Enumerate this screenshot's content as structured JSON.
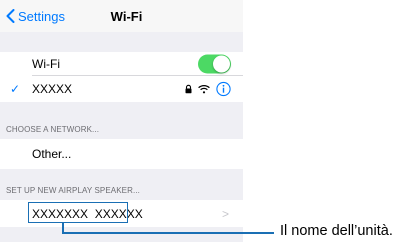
{
  "navbar": {
    "back_label": "Settings",
    "title": "Wi-Fi"
  },
  "wifi_row": {
    "label": "Wi-Fi",
    "toggle_on": true
  },
  "connected_network": {
    "check": "✓",
    "name": "XXXXX"
  },
  "choose_network": {
    "header": "CHOOSE A NETWORK...",
    "other_label": "Other..."
  },
  "airplay": {
    "header": "SET UP NEW AIRPLAY SPEAKER...",
    "device_name": "XXXXXXX  XXXXXX",
    "chevron": ">"
  },
  "annotation": {
    "text": "Il nome dell’unità."
  },
  "colors": {
    "accent": "#007aff",
    "toggle_on": "#4cd964",
    "callout": "#1a6fb4"
  }
}
